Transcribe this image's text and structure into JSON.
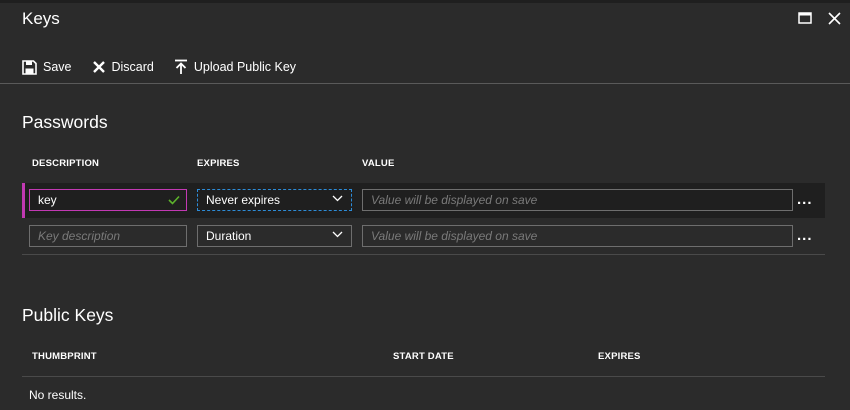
{
  "window": {
    "title": "Keys",
    "maximize_icon": "maximize-icon",
    "close_icon": "close-icon"
  },
  "toolbar": {
    "save_label": "Save",
    "discard_label": "Discard",
    "upload_label": "Upload Public Key"
  },
  "passwords": {
    "section_title": "Passwords",
    "columns": [
      "DESCRIPTION",
      "EXPIRES",
      "VALUE"
    ],
    "rows": [
      {
        "description_value": "key",
        "expires_value": "Never expires",
        "value_placeholder": "Value will be displayed on save",
        "more_label": "..."
      },
      {
        "description_placeholder": "Key description",
        "expires_value": "Duration",
        "value_placeholder": "Value will be displayed on save",
        "more_label": "..."
      }
    ]
  },
  "public_keys": {
    "section_title": "Public Keys",
    "columns": [
      "THUMBPRINT",
      "START DATE",
      "EXPIRES"
    ],
    "empty_text": "No results."
  },
  "colors": {
    "background": "#2b2b2b",
    "selected_row": "#1f1f1f",
    "accent_magenta": "#c239b3",
    "focus_blue": "#2d8cd8",
    "check_green": "#5db32c"
  }
}
